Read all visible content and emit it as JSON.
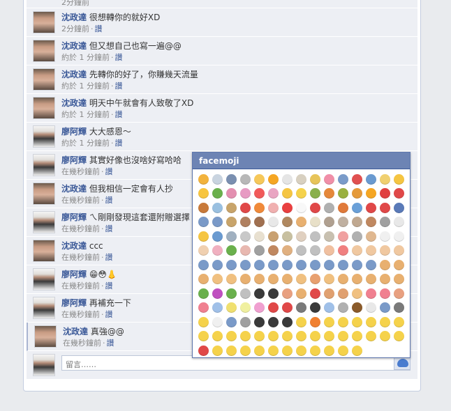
{
  "thread": {
    "comments": [
      {
        "author": "",
        "text": "",
        "time": "2分鐘前",
        "like": "",
        "avatar": "a",
        "partial": true
      },
      {
        "author": "沈政達",
        "text": "很想轉你的就好XD",
        "time": "2分鐘前",
        "like": "讚",
        "avatar": "a"
      },
      {
        "author": "沈政達",
        "text": "但又想自己也寫一遍@@",
        "time": "約於 1 分鐘前",
        "like": "讚",
        "avatar": "a"
      },
      {
        "author": "沈政達",
        "text": "先轉你的好了，你賺幾天流量",
        "time": "約於 1 分鐘前",
        "like": "讚",
        "avatar": "a"
      },
      {
        "author": "沈政達",
        "text": "明天中午就會有人致敬了XD",
        "time": "約於 1 分鐘前",
        "like": "讚",
        "avatar": "a"
      },
      {
        "author": "廖阿輝",
        "text": "大大感恩～",
        "time": "約於 1 分鐘前",
        "like": "讚",
        "avatar": "b"
      },
      {
        "author": "廖阿輝",
        "text": "其實好像也沒啥好寫哈哈",
        "time": "在幾秒鐘前",
        "like": "讚",
        "avatar": "b"
      },
      {
        "author": "沈政達",
        "text": "但我相信一定會有人抄",
        "time": "在幾秒鐘前",
        "like": "讚",
        "avatar": "a"
      },
      {
        "author": "廖阿輝",
        "text": "ㄟ剛剛發現這套還附贈選擇",
        "time": "在幾秒鐘前",
        "like": "讚",
        "avatar": "b"
      },
      {
        "author": "沈政達",
        "text": "ccc",
        "time": "在幾秒鐘前",
        "like": "讚",
        "avatar": "a"
      },
      {
        "author": "廖阿輝",
        "text": "😁😳👃",
        "time": "在幾秒鐘前",
        "like": "讚",
        "avatar": "b"
      },
      {
        "author": "廖阿輝",
        "text": "再補充一下",
        "time": "在幾秒鐘前",
        "like": "讚",
        "avatar": "b"
      },
      {
        "author": "沈政達",
        "text": "真強@@",
        "time": "在幾秒鐘前",
        "like": "讚",
        "avatar": "a",
        "highlight": true
      }
    ]
  },
  "composer": {
    "placeholder": "留言……"
  },
  "facemoji": {
    "title": "facemoji",
    "emoji_colors": [
      "#f2b33d",
      "#c9d4e0",
      "#7a8fb0",
      "#b8b8b8",
      "#f6c85a",
      "#f5a623",
      "#e5e5e5",
      "#d8d0c0",
      "#e7c45a",
      "#f08fa8",
      "#7a9bc9",
      "#e05050",
      "#6a9ad0",
      "#f0d070",
      "#f5c542",
      "#f7c53f",
      "#6ab04c",
      "#e38fb0",
      "#e79bc3",
      "#f15a5a",
      "#e9a5c2",
      "#f5c542",
      "#f5d24b",
      "#8ab04c",
      "#e5883a",
      "#9ab040",
      "#e59a3a",
      "#f5a623",
      "#e04040",
      "#e04848",
      "#c87a3a",
      "#9ac0e0",
      "#c8a46a",
      "#e04848",
      "#f08a3a",
      "#f0b0b0",
      "#e94040",
      "#f8f8f8",
      "#e04848",
      "#b0b0b0",
      "#e07a3a",
      "#6aa0d8",
      "#e04848",
      "#e04848",
      "#5a7ab8",
      "#7a9ac8",
      "#7a9ac8",
      "#c8a46a",
      "#b08060",
      "#a07050",
      "#e8e8e8",
      "#b08860",
      "#e8b070",
      "#e8e0c8",
      "#b0a090",
      "#c0b0a0",
      "#c0a890",
      "#c08860",
      "#a0a0a0",
      "#e8e8e8",
      "#f5c542",
      "#6a9ad0",
      "#a0b0c0",
      "#c8c8c8",
      "#e8e0d0",
      "#c8a070",
      "#c8c0a0",
      "#e0d0c0",
      "#c0c0c0",
      "#c8c0b0",
      "#f0a0a0",
      "#b0b0b0",
      "#e0b890",
      "#f0f0f0",
      "#f0f0f0",
      "#f0d0b0",
      "#f0b0c0",
      "#6ab04c",
      "#e8b8b0",
      "#a0a0a0",
      "#c08860",
      "#e0b080",
      "#c0c0c0",
      "#c0c0c0",
      "#f0c0a0",
      "#f08080",
      "#f0c8a0",
      "#f0c8a0",
      "#f0c8a0",
      "#f0c8a0",
      "#7a9ac8",
      "#7a9ac8",
      "#7a9ac8",
      "#7a9ac8",
      "#7a9ac8",
      "#7a9ac8",
      "#7a9ac8",
      "#7a9ac8",
      "#7a9ac8",
      "#7a9ac8",
      "#7a9ac8",
      "#7a9ac8",
      "#7a9ac8",
      "#e8b070",
      "#e8b070",
      "#e8b070",
      "#f0c080",
      "#f0c080",
      "#e8b070",
      "#e8b070",
      "#e8b070",
      "#e8b070",
      "#f0c080",
      "#e8a070",
      "#f0c080",
      "#e8b070",
      "#e8b070",
      "#e8b070",
      "#e8b070",
      "#e8b070",
      "#6ab04c",
      "#c050c0",
      "#6ab04c",
      "#c0c0c0",
      "#3a3a3a",
      "#3a3a3a",
      "#e8a080",
      "#e8b070",
      "#e04848",
      "#e0a070",
      "#e0a070",
      "#f0c080",
      "#f08090",
      "#f08090",
      "#e8a080",
      "#f08090",
      "#a0c0e8",
      "#f0e070",
      "#f0f0a0",
      "#f0a0d0",
      "#e04848",
      "#e04848",
      "#7a7a7a",
      "#3a3a3a",
      "#a0c0e8",
      "#b0b0b0",
      "#8a5a2a",
      "#e8e8e8",
      "#7a9ac8",
      "#7a7a7a",
      "#f5d24b",
      "#f0f0f0",
      "#7a9ac8",
      "#a0a0a0",
      "#3a3a3a",
      "#3a3a3a",
      "#3a3a3a",
      "#f5d24b",
      "#f08030",
      "#f5d24b",
      "#f5d24b",
      "#f5d24b",
      "#f5d24b",
      "#f5d24b",
      "#f5d24b",
      "#f5d24b",
      "#f5d24b",
      "#f5d24b",
      "#f5d24b",
      "#f5d24b",
      "#f5d24b",
      "#f5d24b",
      "#f5d24b",
      "#f5d24b",
      "#f5d24b",
      "#f5d24b",
      "#f5d24b",
      "#f5d24b",
      "#f5d24b",
      "#f5d24b",
      "#e04848",
      "#f5d24b",
      "#f5d24b",
      "#f5d24b",
      "#f5d24b",
      "#f5d24b",
      "#f5d24b",
      "#f5d24b",
      "#f5d24b",
      "#f5d24b",
      "#f5d24b",
      "#f5d24b"
    ]
  }
}
